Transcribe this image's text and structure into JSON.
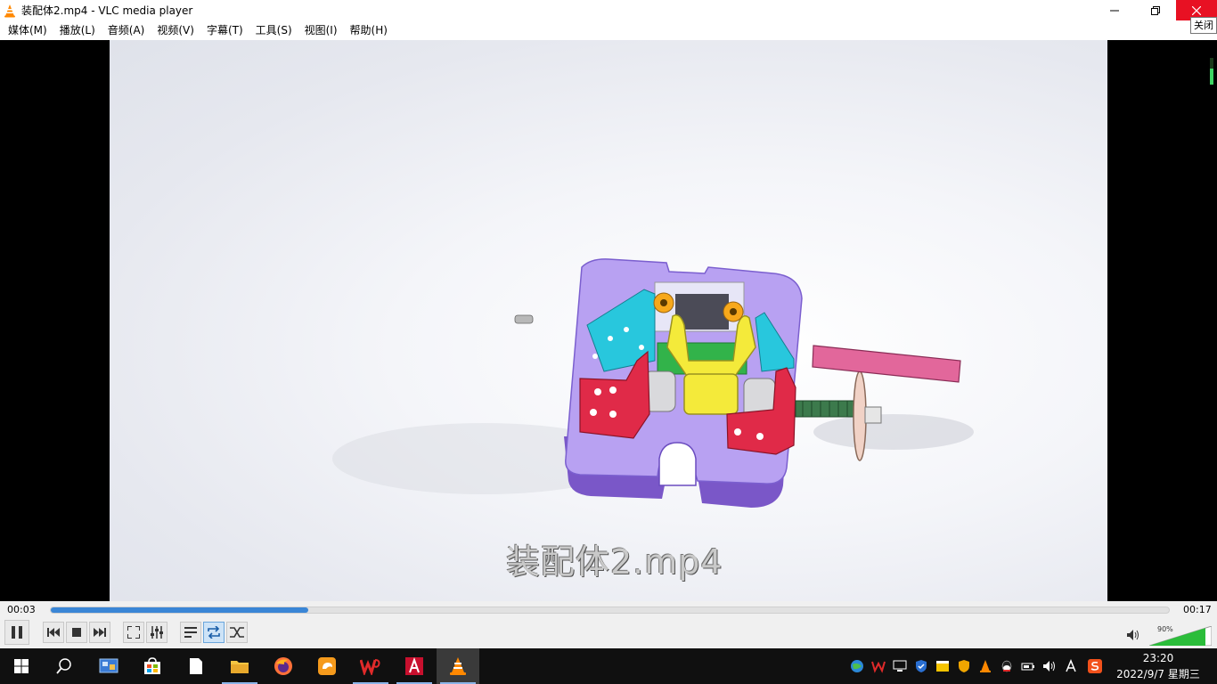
{
  "window": {
    "title": "装配体2.mp4 - VLC media player",
    "close_tooltip": "关闭"
  },
  "menu": [
    "媒体(M)",
    "播放(L)",
    "音频(A)",
    "视频(V)",
    "字幕(T)",
    "工具(S)",
    "视图(I)",
    "帮助(H)"
  ],
  "video": {
    "overlay_title": "装配体2.mp4"
  },
  "playback": {
    "current_time": "00:03",
    "total_time": "00:17",
    "progress": 0.23
  },
  "controls": {
    "loop_active": true,
    "volume_label": "90%",
    "volume_level": 0.9
  },
  "taskbar": {
    "apps": [
      "start-icon",
      "search-icon",
      "control-panel-icon",
      "store-icon",
      "file-icon",
      "explorer-icon",
      "firefox-icon",
      "uc-browser-icon",
      "wps-icon",
      "autocad-icon",
      "vlc-icon"
    ],
    "clock_time": "23:20",
    "clock_date": "2022/9/7 星期三"
  },
  "colors": {
    "accent": "#3a86d6",
    "close_red": "#e81123",
    "vlc_orange": "#ff8800"
  }
}
